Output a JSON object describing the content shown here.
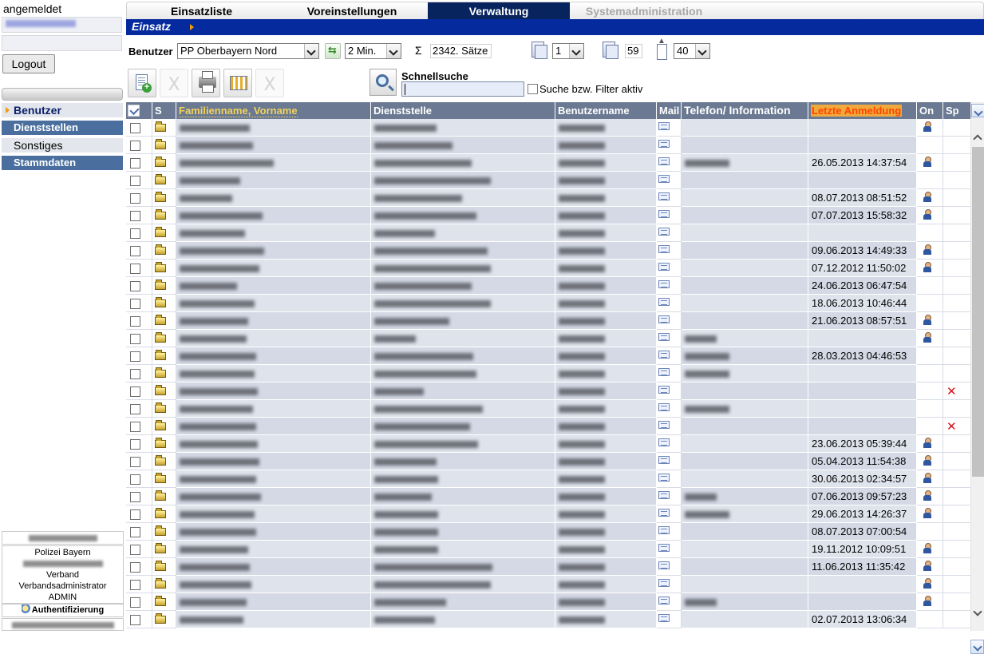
{
  "sidebar": {
    "logged_in_label": "angemeldet",
    "logout_label": "Logout",
    "nav": [
      {
        "label": "Benutzer",
        "active": true
      },
      {
        "label": "Dienststellen"
      },
      {
        "label": "Sonstiges"
      },
      {
        "label": "Stammdaten"
      }
    ],
    "info": {
      "org": "Polizei Bayern",
      "level": "Verband",
      "role": "Verbandsadministrator",
      "group": "ADMIN",
      "auth_label": "Authentifizierung"
    }
  },
  "tabs": [
    {
      "label": "Einsatzliste"
    },
    {
      "label": "Voreinstellungen"
    },
    {
      "label": "Verwaltung",
      "active": true
    },
    {
      "label": "Systemadministration",
      "disabled": true
    }
  ],
  "section": {
    "title": "Einsatz"
  },
  "filter": {
    "label": "Benutzer",
    "org_value": "PP Oberbayern Nord",
    "interval_value": "2 Min.",
    "records": "2342. Sätze",
    "page": "1",
    "total_pages": "59",
    "page_size": "40"
  },
  "search": {
    "label": "Schnellsuche",
    "value": "",
    "filter_label": "Suche bzw. Filter aktiv"
  },
  "table": {
    "headers": {
      "s": "S",
      "name": "Familienname, Vorname",
      "dienststelle": "Dienststelle",
      "username": "Benutzername",
      "mail": "Mail",
      "tel": "Telefon/ Information",
      "last": "Letzte Anmeldung",
      "on": "On",
      "sp": "Sp"
    },
    "rows": [
      {
        "last": "",
        "on": true,
        "sp": false,
        "tel": false
      },
      {
        "last": "",
        "on": false,
        "sp": false,
        "tel": false
      },
      {
        "last": "26.05.2013 14:37:54",
        "on": true,
        "sp": false,
        "tel": true
      },
      {
        "last": "",
        "on": false,
        "sp": false,
        "tel": false
      },
      {
        "last": "08.07.2013 08:51:52",
        "on": true,
        "sp": false,
        "tel": false
      },
      {
        "last": "07.07.2013 15:58:32",
        "on": true,
        "sp": false,
        "tel": false
      },
      {
        "last": "",
        "on": false,
        "sp": false,
        "tel": false
      },
      {
        "last": "09.06.2013 14:49:33",
        "on": true,
        "sp": false,
        "tel": false
      },
      {
        "last": "07.12.2012 11:50:02",
        "on": true,
        "sp": false,
        "tel": false
      },
      {
        "last": "24.06.2013 06:47:54",
        "on": false,
        "sp": false,
        "tel": false
      },
      {
        "last": "18.06.2013 10:46:44",
        "on": false,
        "sp": false,
        "tel": false
      },
      {
        "last": "21.06.2013 08:57:51",
        "on": true,
        "sp": false,
        "tel": false
      },
      {
        "last": "",
        "on": true,
        "sp": false,
        "tel": true
      },
      {
        "last": "28.03.2013 04:46:53",
        "on": false,
        "sp": false,
        "tel": true
      },
      {
        "last": "",
        "on": false,
        "sp": false,
        "tel": true
      },
      {
        "last": "",
        "on": false,
        "sp": true,
        "tel": false
      },
      {
        "last": "",
        "on": false,
        "sp": false,
        "tel": true
      },
      {
        "last": "",
        "on": false,
        "sp": true,
        "tel": false
      },
      {
        "last": "23.06.2013 05:39:44",
        "on": true,
        "sp": false,
        "tel": false
      },
      {
        "last": "05.04.2013 11:54:38",
        "on": true,
        "sp": false,
        "tel": false
      },
      {
        "last": "30.06.2013 02:34:57",
        "on": true,
        "sp": false,
        "tel": false
      },
      {
        "last": "07.06.2013 09:57:23",
        "on": true,
        "sp": false,
        "tel": true
      },
      {
        "last": "29.06.2013 14:26:37",
        "on": true,
        "sp": false,
        "tel": true
      },
      {
        "last": "08.07.2013 07:00:54",
        "on": false,
        "sp": false,
        "tel": false
      },
      {
        "last": "19.11.2012 10:09:51",
        "on": true,
        "sp": false,
        "tel": false
      },
      {
        "last": "11.06.2013 11:35:42",
        "on": true,
        "sp": false,
        "tel": false
      },
      {
        "last": "",
        "on": true,
        "sp": false,
        "tel": false
      },
      {
        "last": "",
        "on": true,
        "sp": false,
        "tel": true
      },
      {
        "last": "02.07.2013 13:06:34",
        "on": false,
        "sp": false,
        "tel": false
      }
    ]
  },
  "colors": {
    "section_bar": "#052a9e",
    "active_tab": "#08245e",
    "header": "#6b7a92",
    "sort_highlight": "#f0a93d"
  }
}
